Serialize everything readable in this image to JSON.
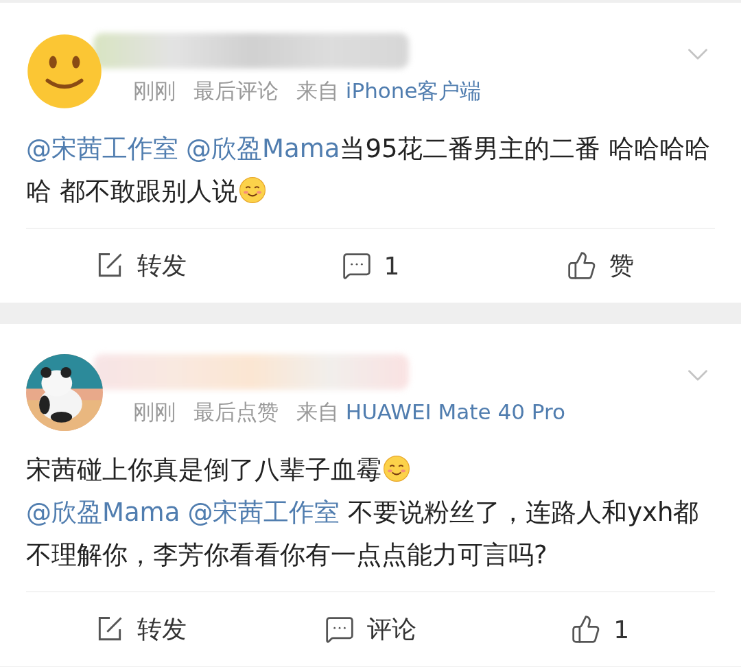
{
  "posts": [
    {
      "avatar": {
        "kind": "smiley"
      },
      "meta": {
        "time": "刚刚",
        "activity": "最后评论",
        "source_prefix": "来自",
        "source": "iPhone客户端"
      },
      "body": [
        {
          "kind": "mention",
          "text": "@宋茜工作室"
        },
        {
          "kind": "mention",
          "text": "@欣盈Mama"
        },
        {
          "kind": "text",
          "text": "当95花二番男主的二番 哈哈哈哈哈 都不敢跟别人说"
        },
        {
          "kind": "emoji"
        }
      ],
      "actions": [
        {
          "kind": "repost",
          "label": "转发"
        },
        {
          "kind": "comment",
          "label": "1"
        },
        {
          "kind": "like",
          "label": "赞"
        }
      ]
    },
    {
      "avatar": {
        "kind": "picture"
      },
      "meta": {
        "time": "刚刚",
        "activity": "最后点赞",
        "source_prefix": "来自",
        "source": "HUAWEI Mate 40 Pro"
      },
      "body": [
        {
          "kind": "text",
          "text": "宋茜碰上你真是倒了八辈子血霉"
        },
        {
          "kind": "emoji"
        },
        {
          "kind": "mention",
          "text": "@欣盈Mama"
        },
        {
          "kind": "mention",
          "text": "@宋茜工作室"
        },
        {
          "kind": "text",
          "text": " 不要说粉丝了，连路人和yxh都不理解你，李芳你看看你有一点点能力可言吗?"
        }
      ],
      "actions": [
        {
          "kind": "repost",
          "label": "转发"
        },
        {
          "kind": "comment",
          "label": "评论"
        },
        {
          "kind": "like",
          "label": "1"
        }
      ]
    }
  ]
}
